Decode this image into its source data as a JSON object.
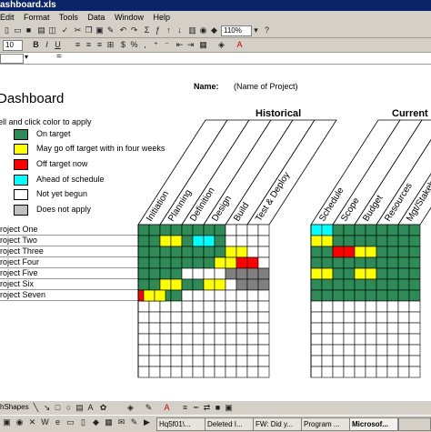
{
  "window": {
    "title": "ashboard.xls"
  },
  "menu": [
    "Edit",
    "Format",
    "Tools",
    "Data",
    "Window",
    "Help"
  ],
  "toolbar": {
    "zoom": "110%",
    "font_size": "10"
  },
  "sheet": {
    "title": "Dashboard",
    "name_label": "Name:",
    "name_value": "(Name of Project)",
    "instructions": "ell and click color to apply",
    "section_historical": "Historical",
    "section_current": "Current"
  },
  "legend": [
    {
      "color": "#2e8b57",
      "label": "On target"
    },
    {
      "color": "#ffff00",
      "label": "May go off target with in four weeks"
    },
    {
      "color": "#ff0000",
      "label": "Off target now"
    },
    {
      "color": "#00ffff",
      "label": "Ahead of schedule"
    },
    {
      "color": "#ffffff",
      "label": "Not yet begun"
    },
    {
      "color": "#c0c0c0",
      "label": "Does not apply"
    }
  ],
  "historical_columns": [
    "Initiation",
    "Planning",
    "Definition",
    "Design",
    "Build",
    "Test & Deploy"
  ],
  "current_columns": [
    "Schedule",
    "Scope",
    "Budget",
    "Resources",
    "Mgt/Stakehol"
  ],
  "projects": [
    "roject One",
    "roject Two",
    "roject Three",
    "roject Four",
    "roject Five",
    "roject Six",
    "roject Seven"
  ],
  "palette": {
    "G": "#2e8b57",
    "Y": "#ffff00",
    "R": "#ff0000",
    "C": "#00ffff",
    "W": "#ffffff",
    "S": "#808080"
  },
  "historical_status": [
    [
      "G",
      "G",
      "G",
      "G",
      "G",
      "G",
      "G",
      "G",
      "W",
      "W",
      "W",
      "W"
    ],
    [
      "G",
      "G",
      "Y",
      "Y",
      "G",
      "C",
      "C",
      "G",
      "W",
      "W",
      "W",
      "W"
    ],
    [
      "G",
      "G",
      "G",
      "G",
      "G",
      "G",
      "G",
      "G",
      "Y",
      "Y",
      "W",
      "W"
    ],
    [
      "G",
      "G",
      "G",
      "G",
      "G",
      "G",
      "G",
      "Y",
      "Y",
      "R",
      "R",
      "W"
    ],
    [
      "G",
      "G",
      "G",
      "G",
      "W",
      "W",
      "W",
      "W",
      "S",
      "S",
      "S",
      "S"
    ],
    [
      "G",
      "G",
      "Y",
      "Y",
      "G",
      "G",
      "Y",
      "Y",
      "W",
      "S",
      "S",
      "S"
    ],
    [
      "G",
      "G",
      "G",
      "G",
      "W",
      "W",
      "W",
      "W",
      "W",
      "W",
      "W",
      "W"
    ]
  ],
  "current_status": [
    [
      "C",
      "C",
      "G",
      "G",
      "G",
      "G",
      "G",
      "G",
      "G",
      "G"
    ],
    [
      "Y",
      "Y",
      "G",
      "G",
      "G",
      "G",
      "G",
      "G",
      "G",
      "G"
    ],
    [
      "G",
      "G",
      "R",
      "R",
      "Y",
      "Y",
      "G",
      "G",
      "G",
      "G"
    ],
    [
      "G",
      "G",
      "G",
      "G",
      "G",
      "G",
      "G",
      "G",
      "G",
      "G"
    ],
    [
      "Y",
      "Y",
      "G",
      "G",
      "Y",
      "Y",
      "G",
      "G",
      "G",
      "G"
    ],
    [
      "G",
      "G",
      "G",
      "G",
      "G",
      "G",
      "G",
      "G",
      "G",
      "G"
    ],
    [
      "G",
      "G",
      "G",
      "G",
      "G",
      "G",
      "G",
      "G",
      "G",
      "G"
    ]
  ],
  "project7_extra": {
    "first": "R",
    "yellow_run": [
      "Y",
      "Y"
    ]
  },
  "taskbar": {
    "drawing_label": "hShapes",
    "tasks": [
      "Hq5f01\\...",
      "Deleted I...",
      "FW: Did y...",
      "Program ...",
      "Microsof..."
    ]
  }
}
